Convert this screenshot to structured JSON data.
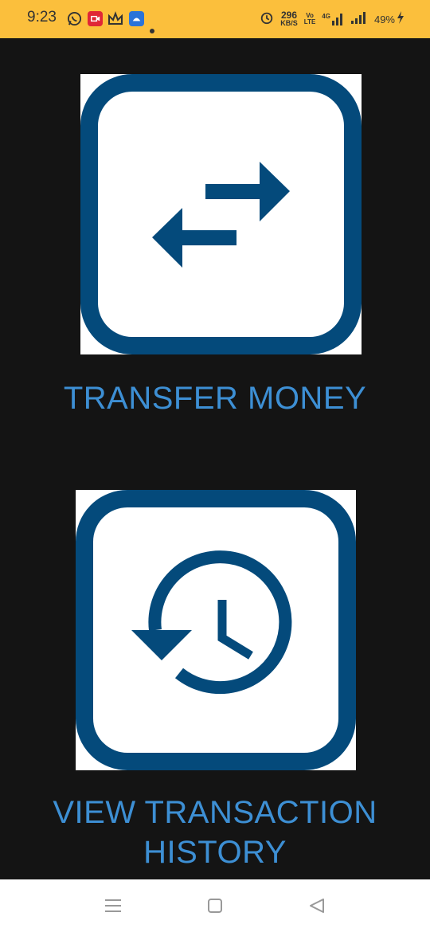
{
  "status_bar": {
    "time": "9:23",
    "net_speed_value": "296",
    "net_speed_unit": "KB/S",
    "volte_line1": "Vo",
    "volte_line2": "LTE",
    "network_type": "4G",
    "battery_percent": "49%",
    "icons": [
      "whatsapp-icon",
      "screen-recorder-icon",
      "crown-app-icon",
      "android-app-icon",
      "notification-dot-icon",
      "alarm-icon",
      "volte-icon",
      "signal-icon",
      "battery-charging-icon"
    ],
    "background_color": "#fbbf3c"
  },
  "main": {
    "transfer_label": "TRANSFER MONEY",
    "history_label_line1": "VIEW TRANSACTION",
    "history_label_line2": "HISTORY",
    "icon_color": "#044a7b",
    "label_color": "#3d8fd4",
    "background_color": "#141414"
  },
  "nav_bar": {
    "buttons": [
      "menu-icon",
      "home-icon",
      "back-icon"
    ]
  }
}
